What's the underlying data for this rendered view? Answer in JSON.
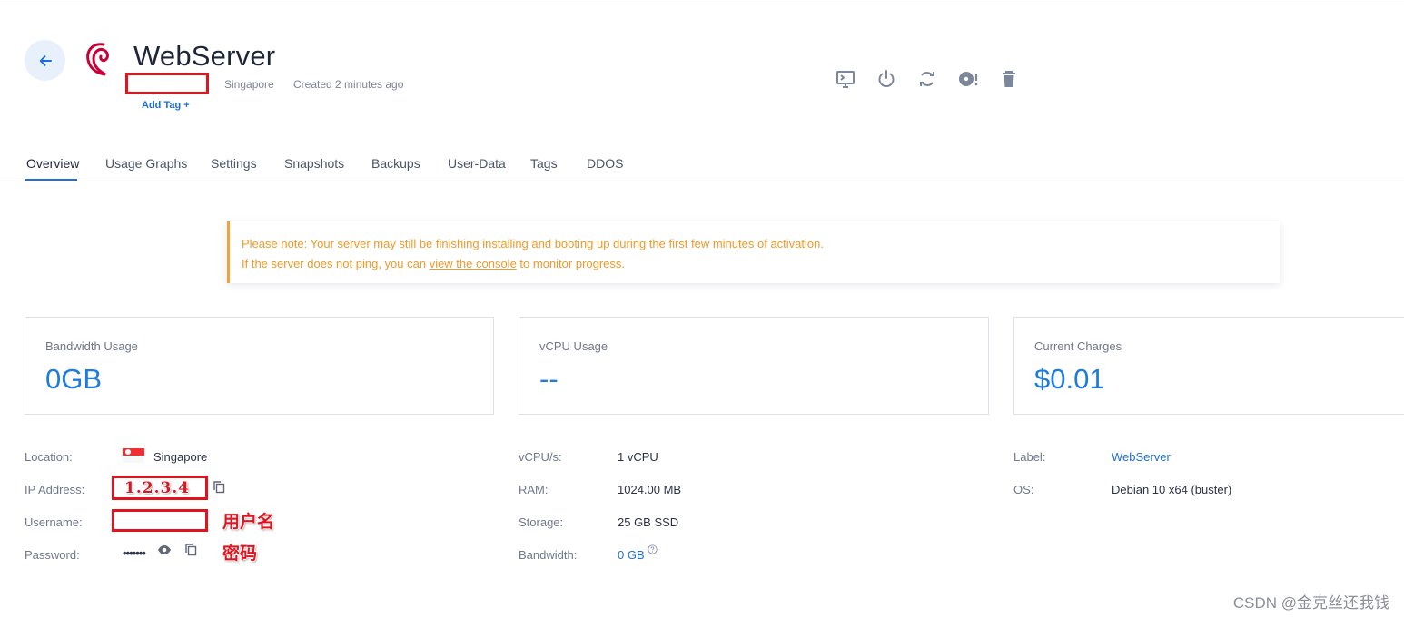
{
  "server": {
    "name": "WebServer",
    "region": "Singapore",
    "created": "Created 2 minutes ago",
    "add_tag": "Add Tag +"
  },
  "tabs": [
    "Overview",
    "Usage Graphs",
    "Settings",
    "Snapshots",
    "Backups",
    "User-Data",
    "Tags",
    "DDOS"
  ],
  "notice": {
    "line1": "Please note: Your server may still be finishing installing and booting up during the first few minutes of activation.",
    "line2_before": "If the server does not ping, you can ",
    "line2_link": "view the console",
    "line2_after": " to monitor progress."
  },
  "cards": [
    {
      "label": "Bandwidth Usage",
      "value": "0GB"
    },
    {
      "label": "vCPU Usage",
      "value": "--"
    },
    {
      "label": "Current Charges",
      "value": "$0.01"
    }
  ],
  "details": {
    "location_label": "Location:",
    "location_value": "Singapore",
    "ip_label": "IP Address:",
    "ip_value": "1.2.3.4",
    "username_label": "Username:",
    "password_label": "Password:",
    "password_value": "•••••••",
    "vcpu_label": "vCPU/s:",
    "vcpu_value": "1 vCPU",
    "ram_label": "RAM:",
    "ram_value": "1024.00 MB",
    "storage_label": "Storage:",
    "storage_value": "25 GB SSD",
    "bandwidth_label": "Bandwidth:",
    "bandwidth_value": "0 GB",
    "server_label_label": "Label:",
    "server_label_value": "WebServer",
    "os_label": "OS:",
    "os_value": "Debian 10 x64 (buster)"
  },
  "annotations": {
    "username": "用户名",
    "password": "密码"
  },
  "watermark": "CSDN @金克丝还我钱",
  "icons": {
    "back": "arrow-left-icon",
    "console": "console-icon",
    "power": "power-icon",
    "restart": "restart-icon",
    "reinstall": "reinstall-disc-icon",
    "delete": "trash-icon",
    "copy": "copy-icon",
    "reveal": "eye-icon",
    "help": "question-icon"
  },
  "colors": {
    "accent": "#1e6fd9",
    "value_blue": "#1e7be0",
    "warning": "#ee9a2c",
    "annotation_red": "#e0141e",
    "icon_gray": "#7d879b"
  }
}
